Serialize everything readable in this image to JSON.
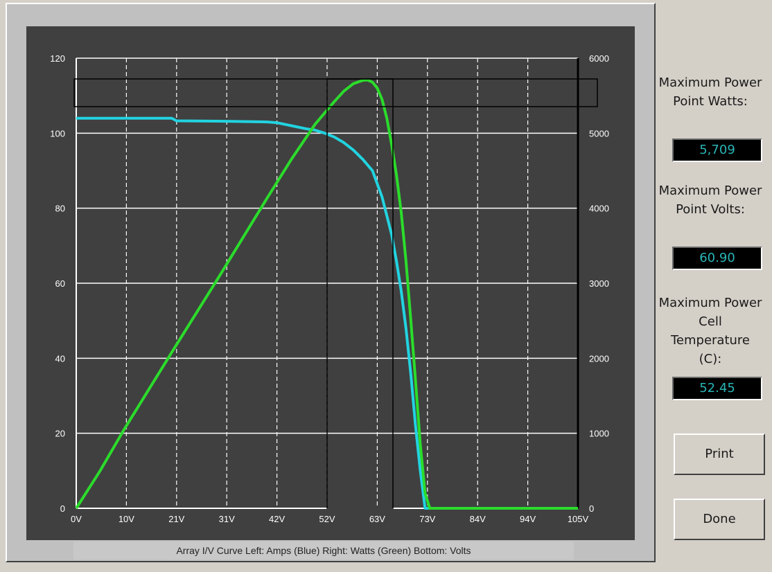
{
  "chart_data": {
    "type": "line",
    "caption": "Array I/V Curve Left: Amps (Blue) Right: Watts (Green) Bottom: Volts",
    "x_tick_labels": [
      "0V",
      "10V",
      "21V",
      "31V",
      "42V",
      "52V",
      "63V",
      "73V",
      "84V",
      "94V",
      "105V"
    ],
    "xlim": [
      0,
      105
    ],
    "y_left_ticks": [
      "0",
      "20",
      "40",
      "60",
      "80",
      "100",
      "120"
    ],
    "ylim_left": [
      0,
      120
    ],
    "y_right_ticks": [
      "0",
      "1000",
      "2000",
      "3000",
      "4000",
      "5000",
      "6000"
    ],
    "ylim_right": [
      0,
      6000
    ],
    "grid": true,
    "series": [
      {
        "axis": "left",
        "color": "#22d3e0",
        "x": [
          0,
          10,
          20,
          21,
          30,
          40,
          42,
          45,
          48,
          50,
          52,
          54,
          56,
          58,
          60,
          62,
          63,
          64,
          65,
          66,
          67,
          68,
          69,
          70,
          71,
          72,
          73,
          74,
          80,
          90,
          105
        ],
        "y": [
          104,
          104,
          104,
          103.3,
          103.2,
          103,
          102.8,
          102,
          101.2,
          100.8,
          100,
          99,
          97.5,
          95.5,
          93,
          90,
          86.5,
          83,
          78,
          73,
          66,
          58,
          48,
          36,
          22,
          10,
          0,
          0,
          0,
          0,
          0
        ]
      },
      {
        "axis": "right",
        "color": "#2bdc2b",
        "x": [
          0,
          5,
          10,
          20,
          30,
          40,
          45,
          50,
          54,
          56,
          58,
          60,
          61,
          62,
          63,
          64,
          65,
          66,
          67,
          68,
          69,
          70,
          71,
          72,
          73,
          74,
          80,
          90,
          105
        ],
        "y": [
          0,
          500,
          1050,
          2080,
          3100,
          4140,
          4650,
          5120,
          5420,
          5560,
          5660,
          5705,
          5709,
          5680,
          5600,
          5450,
          5200,
          4850,
          4450,
          3950,
          3300,
          2520,
          1700,
          850,
          200,
          0,
          0,
          0,
          0
        ]
      }
    ]
  },
  "panel": {
    "mpp_watts_label": "Maximum Power Point Watts:",
    "mpp_watts_value": "5,709",
    "mpp_volts_label": "Maximum Power Point Volts:",
    "mpp_volts_value": "60.90",
    "mpp_temp_label": "Maximum Power Cell Temperature (C):",
    "mpp_temp_value": "52.45",
    "print_label": "Print",
    "done_label": "Done"
  }
}
